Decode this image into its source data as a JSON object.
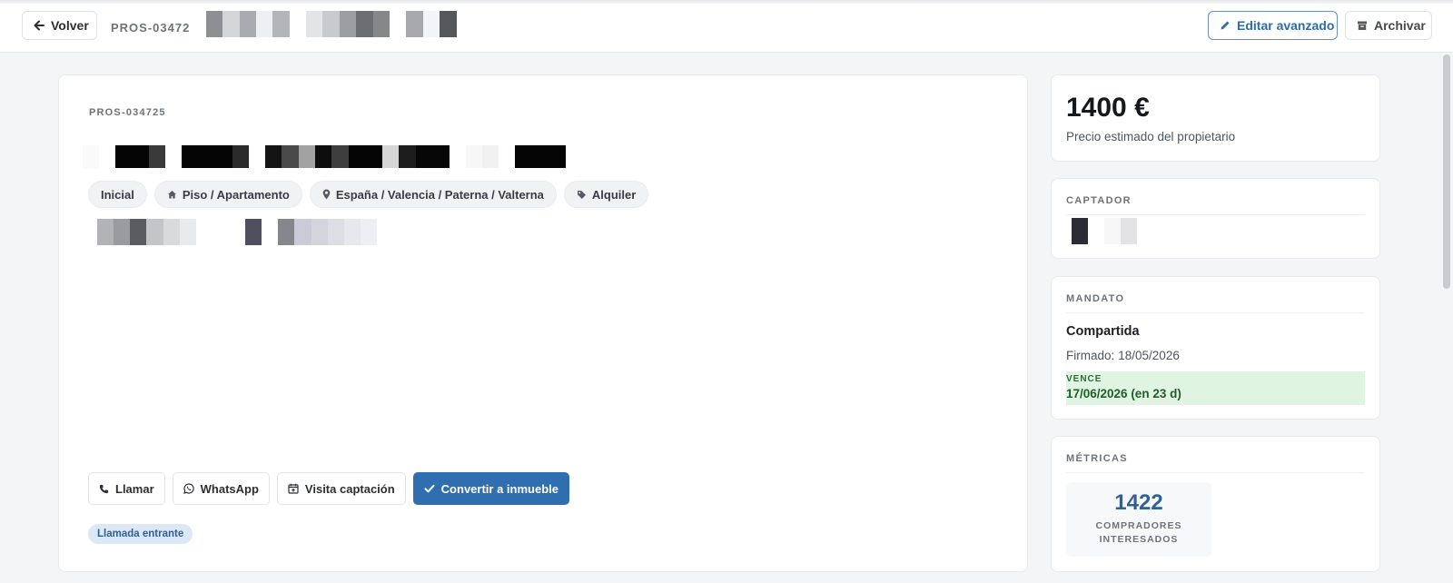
{
  "topbar": {
    "back_label": "Volver",
    "reference": "PROS-03472",
    "edit_label": "Editar avanzado",
    "archive_label": "Archivar"
  },
  "prospect": {
    "code": "PROS-034725",
    "tags": [
      {
        "label": "Inicial",
        "icon": ""
      },
      {
        "label": "Piso / Apartamento",
        "icon": "home-icon"
      },
      {
        "label": "España / Valencia / Paterna / Valterna",
        "icon": "map-pin-icon"
      },
      {
        "label": "Alquiler",
        "icon": "tag-icon"
      }
    ],
    "actions": {
      "call": "Llamar",
      "whatsapp": "WhatsApp",
      "visit": "Visita captación",
      "convert": "Convertir a inmueble"
    },
    "source_badge": "Llamada entrante"
  },
  "price": {
    "value": "1400 €",
    "label": "Precio estimado del propietario"
  },
  "captador": {
    "title": "CAPTADOR"
  },
  "mandato": {
    "title": "MANDATO",
    "type": "Compartida",
    "signed_label": "Firmado:",
    "signed_date": "18/05/2026",
    "expires_label": "VENCE",
    "expires_value": "17/06/2026 (en 23 d)"
  },
  "metrics": {
    "title": "MÉTRICAS",
    "buyers_count": "1422",
    "buyers_label": "COMPRADORES INTERESADOS"
  },
  "colors": {
    "accent": "#2f6fb0",
    "expiry_bg": "#dff5e1",
    "badge_bg": "#dce8f7"
  }
}
